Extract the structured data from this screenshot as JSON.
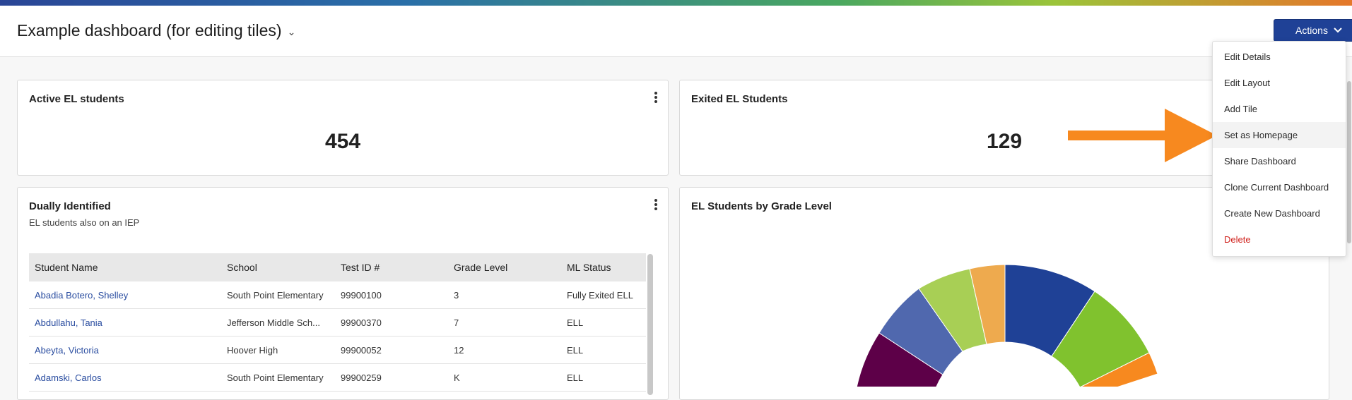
{
  "header": {
    "title": "Example dashboard (for editing tiles)",
    "actions_label": "Actions"
  },
  "menu": {
    "items": [
      {
        "label": "Edit Details"
      },
      {
        "label": "Edit Layout"
      },
      {
        "label": "Add Tile"
      },
      {
        "label": "Set as Homepage"
      },
      {
        "label": "Share Dashboard"
      },
      {
        "label": "Clone Current Dashboard"
      },
      {
        "label": "Create New Dashboard"
      },
      {
        "label": "Delete"
      }
    ],
    "highlighted_index": 3,
    "danger_color": "#d0211c"
  },
  "tiles": {
    "active": {
      "title": "Active EL students",
      "value": "454"
    },
    "exited": {
      "title": "Exited EL Students",
      "value": "129"
    },
    "dual": {
      "title": "Dually Identified",
      "subtitle": "EL students also on an IEP",
      "columns": [
        "Student Name",
        "School",
        "Test ID #",
        "Grade Level",
        "ML Status"
      ],
      "rows": [
        [
          "Abadia Botero, Shelley",
          "South Point Elementary",
          "99900100",
          "3",
          "Fully Exited ELL"
        ],
        [
          "Abdullahu, Tania",
          "Jefferson Middle Sch...",
          "99900370",
          "7",
          "ELL"
        ],
        [
          "Abeyta, Victoria",
          "Hoover High",
          "99900052",
          "12",
          "ELL"
        ],
        [
          "Adamski, Carlos",
          "South Point Elementary",
          "99900259",
          "K",
          "ELL"
        ]
      ]
    },
    "grade": {
      "title": "EL Students by Grade Level"
    }
  },
  "colors": {
    "accent": "#1f4196",
    "link": "#2a4da0",
    "arrow": "#f7891f",
    "donut_segments": [
      "#1f4196",
      "#80c22e",
      "#f7891f",
      "#5d0048",
      "#5068ae",
      "#a8cf55",
      "#eeaa4e"
    ]
  },
  "chart_data": {
    "type": "pie",
    "title": "EL Students by Grade Level",
    "note": "Donut chart partially visible; values not labeled",
    "visible_segments": 7
  }
}
